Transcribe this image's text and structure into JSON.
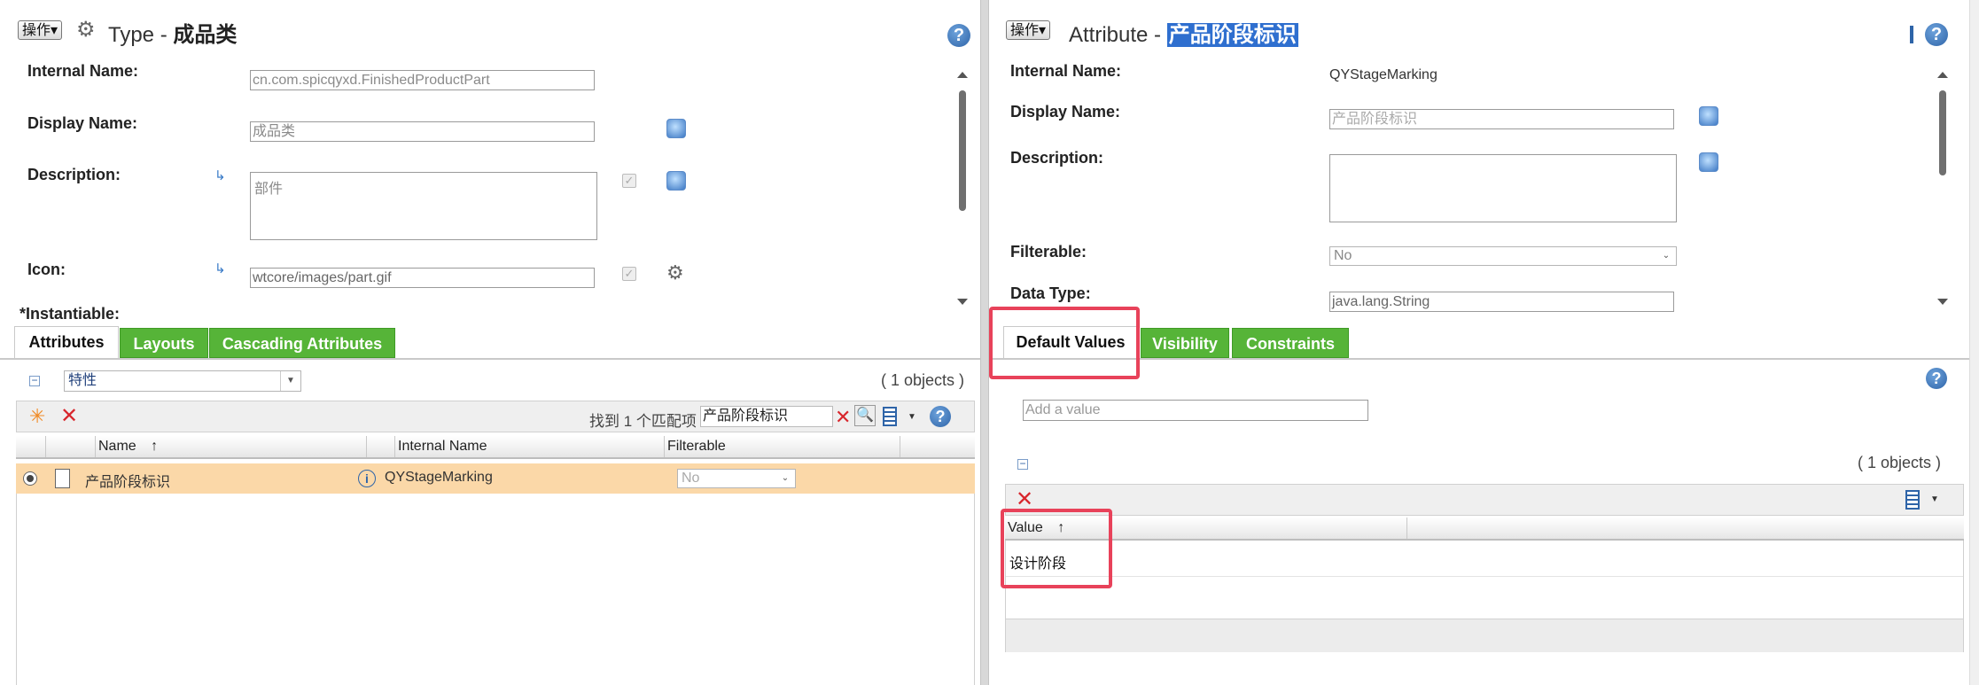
{
  "left": {
    "op_label": "操作▾",
    "title_prefix": "Type - ",
    "title_name": "成品类",
    "fields": {
      "internal_name_label": "Internal Name:",
      "internal_name_value": "cn.com.spicqyxd.FinishedProductPart",
      "display_name_label": "Display Name:",
      "display_name_value": "成品类",
      "description_label": "Description:",
      "description_value": "部件",
      "icon_label": "Icon:",
      "icon_value": "wtcore/images/part.gif",
      "instantiable_label": "*Instantiable:"
    },
    "tabs": [
      "Attributes",
      "Layouts",
      "Cascading Attributes"
    ],
    "filter_select": "特性",
    "objects_count": "( 1 objects )",
    "search_found": "找到 1 个匹配项",
    "search_value": "产品阶段标识",
    "columns": [
      "Name",
      "Internal Name",
      "Filterable"
    ],
    "sort_indicator": "↑",
    "row": {
      "name": "产品阶段标识",
      "internal_name": "QYStageMarking",
      "filterable": "No"
    }
  },
  "right": {
    "op_label": "操作▾",
    "title_prefix": "Attribute - ",
    "title_name": "产品阶段标识",
    "fields": {
      "internal_name_label": "Internal Name:",
      "internal_name_value": "QYStageMarking",
      "display_name_label": "Display Name:",
      "display_name_value": "产品阶段标识",
      "description_label": "Description:",
      "filterable_label": "Filterable:",
      "filterable_value": "No",
      "data_type_label": "Data Type:",
      "data_type_value": "java.lang.String"
    },
    "tabs": [
      "Default Values",
      "Visibility",
      "Constraints"
    ],
    "add_value_placeholder": "Add a value",
    "objects_count": "( 1 objects )",
    "value_column": "Value",
    "sort_indicator": "↑",
    "value_row": "设计阶段"
  },
  "colors": {
    "tab_green": "#56b438",
    "selected_row": "#fbd8a8",
    "highlight_box": "#e8425a",
    "title_highlight": "#2f6fcf"
  }
}
